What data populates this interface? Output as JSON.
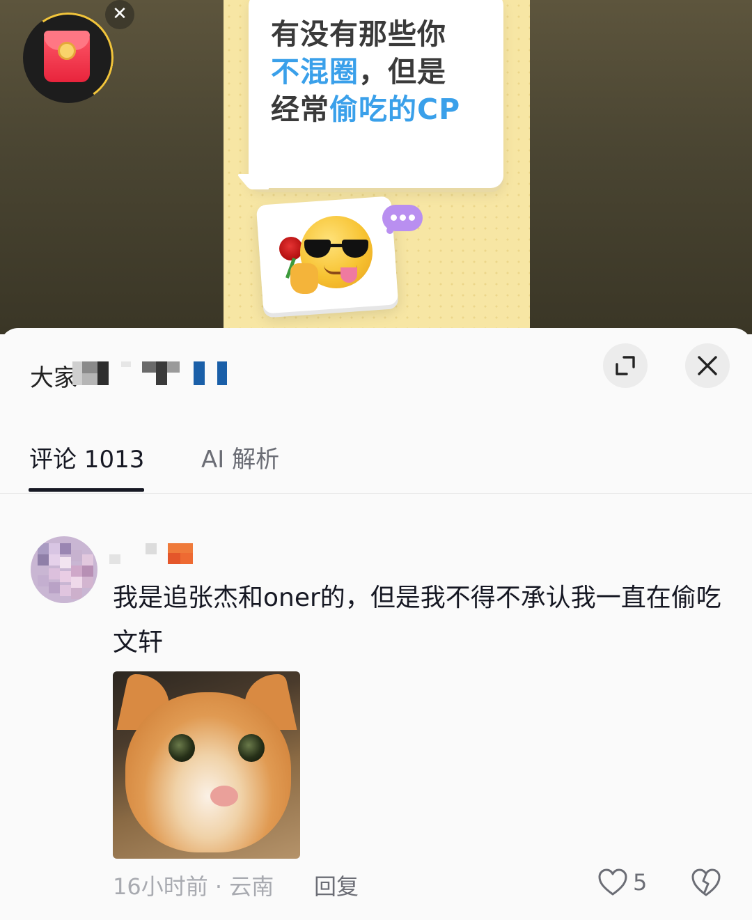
{
  "video": {
    "poster_line1": "有没有那些你",
    "poster_line2_highlight": "不混圈",
    "poster_line2_rest": "，但是",
    "poster_line3_prefix": "经常",
    "poster_line3_highlight": "偷吃的CP",
    "emoji": "sunglasses-tongue-rose-emoji",
    "close_symbol": "✕"
  },
  "panel": {
    "title_visible": "大家",
    "title_obscured": true
  },
  "tabs": [
    {
      "label": "评论 1013",
      "active": true
    },
    {
      "label": "AI 解析",
      "active": false
    }
  ],
  "comment": {
    "username_obscured": true,
    "text": "我是追张杰和oner的，但是我不得不承认我一直在偷吃文轩",
    "image": "orange-white-cat-photo",
    "time_location": "16小时前 · 云南",
    "reply_label": "回复",
    "like_count": "5"
  },
  "colors": {
    "highlight_blue": "#3aa0ea",
    "poster_yellow": "#f7e6a4",
    "panel_bg": "#fafafa",
    "primary_text": "#161823",
    "secondary_text": "#a8aab0"
  }
}
